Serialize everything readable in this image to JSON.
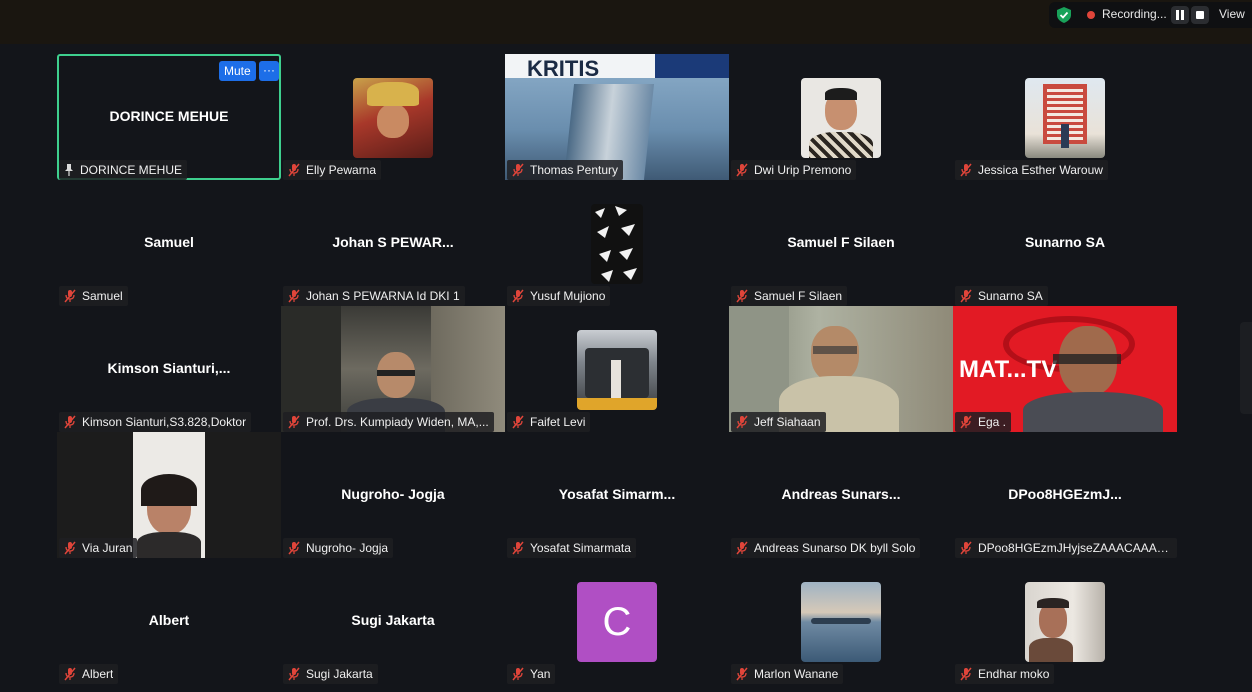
{
  "recording": {
    "label": "Recording...",
    "view_label": "View"
  },
  "active_tile": {
    "mute_label": "Mute",
    "more_label": "···"
  },
  "colors": {
    "background": "#13151a",
    "active_border": "#3ecf8e",
    "button_blue": "#1d6ee8",
    "muted_mic": "#e0453a",
    "avatar_purple": "#b04fc4"
  },
  "tiles": [
    {
      "center_name": "DORINCE MEHUE",
      "label": "DORINCE MEHUE"
    },
    {
      "label": "Elly Pewarna"
    },
    {
      "label": "Thomas Pentury",
      "screen_text": "KRITIS"
    },
    {
      "label": "Dwi Urip Premono"
    },
    {
      "label": "Jessica Esther Warouw"
    },
    {
      "center_name": "Samuel",
      "label": "Samuel"
    },
    {
      "center_name": "Johan  S  PEWAR...",
      "label": "Johan S PEWARNA Id DKI 1"
    },
    {
      "label": "Yusuf Mujiono"
    },
    {
      "center_name": "Samuel F Silaen",
      "label": "Samuel F Silaen"
    },
    {
      "center_name": "Sunarno SA",
      "label": "Sunarno SA"
    },
    {
      "center_name": "Kimson  Sianturi,...",
      "label": "Kimson Sianturi,S3.828,Doktor"
    },
    {
      "label": "Prof. Drs. Kumpiady Widen, MA,..."
    },
    {
      "label": "Faifet Levi"
    },
    {
      "label": "Jeff Siahaan"
    },
    {
      "label": "Ega .",
      "screen_text": "MAT...TV"
    },
    {
      "label": "Via Juran"
    },
    {
      "center_name": "Nugroho- Jogja",
      "label": "Nugroho- Jogja"
    },
    {
      "center_name": "Yosafat  Simarm...",
      "label": "Yosafat Simarmata"
    },
    {
      "center_name": "Andreas  Sunars...",
      "label": "Andreas Sunarso DK byll Solo"
    },
    {
      "center_name": "DPoo8HGEzmJ...",
      "label": "DPoo8HGEzmJHyjseZAAACAAAA..."
    },
    {
      "center_name": "Albert",
      "label": "Albert"
    },
    {
      "center_name": "Sugi Jakarta",
      "label": "Sugi Jakarta"
    },
    {
      "label": "Yan",
      "avatar_letter": "C"
    },
    {
      "label": "Marlon Wanane"
    },
    {
      "label": "Endhar moko"
    }
  ]
}
